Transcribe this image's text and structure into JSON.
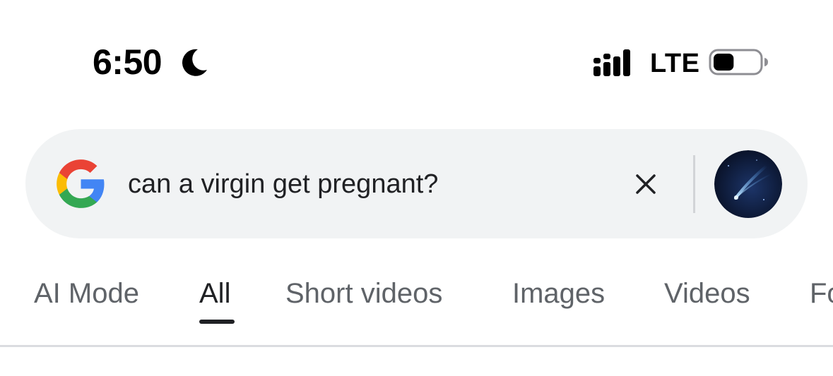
{
  "status_bar": {
    "time": "6:50",
    "network": "LTE",
    "icons": [
      "moon-icon",
      "cellular-signal-icon",
      "battery-icon"
    ],
    "battery_level": 0.45
  },
  "search": {
    "query": "can a virgin get pregnant?",
    "icons": [
      "google-g-logo",
      "close-icon",
      "profile-avatar"
    ]
  },
  "tabs": [
    {
      "label": "AI Mode",
      "active": false
    },
    {
      "label": "All",
      "active": true
    },
    {
      "label": "Short videos",
      "active": false
    },
    {
      "label": "Images",
      "active": false
    },
    {
      "label": "Videos",
      "active": false
    },
    {
      "label": "Fo",
      "active": false
    }
  ],
  "colors": {
    "search_bg": "#f1f3f4",
    "tab_inactive": "#5f6368",
    "tab_active": "#202124",
    "google_blue": "#4285F4",
    "google_red": "#EA4335",
    "google_yellow": "#FBBC05",
    "google_green": "#34A853"
  }
}
